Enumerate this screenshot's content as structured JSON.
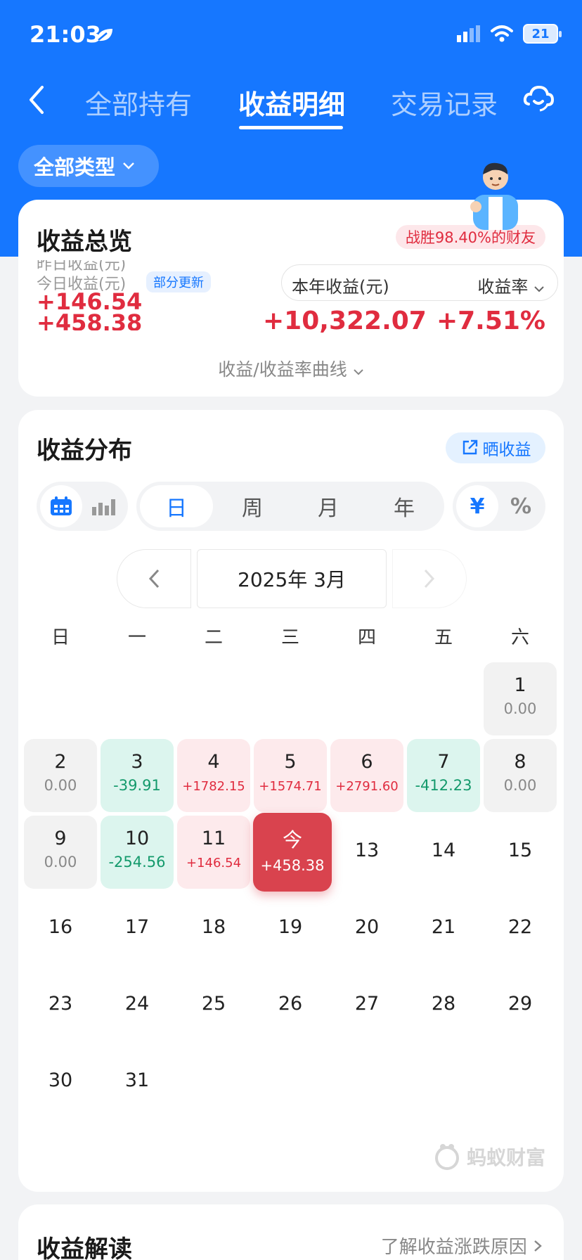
{
  "status": {
    "time": "21:03",
    "battery": "21"
  },
  "nav": {
    "tabs": [
      {
        "label": "全部持有"
      },
      {
        "label": "收益明细"
      },
      {
        "label": "交易记录"
      }
    ]
  },
  "filter": {
    "label": "全部类型"
  },
  "overview": {
    "title": "收益总览",
    "win_badge": "战胜98.40%的财友",
    "yesterday_label_partial": "昨日收益(元)",
    "today_label": "今日收益(元)",
    "partial_update": "部分更新",
    "yesterday_value_partial": "+146.54",
    "today_value": "+458.38",
    "year_label": "本年收益(元)",
    "rate_selector": "收益率",
    "year_value": "+10,322.07",
    "rate_value": "+7.51%",
    "curve_link": "收益/收益率曲线"
  },
  "distribution": {
    "title": "收益分布",
    "share_label": "晒收益",
    "periods": [
      "日",
      "周",
      "月",
      "年"
    ],
    "unit_yuan": "¥",
    "unit_percent": "%",
    "month": "2025年 3月",
    "weekdays": [
      "日",
      "一",
      "二",
      "三",
      "四",
      "五",
      "六"
    ],
    "days": [
      {
        "num": "1",
        "amt": "0.00",
        "type": "zero"
      },
      {
        "num": "2",
        "amt": "0.00",
        "type": "zero"
      },
      {
        "num": "3",
        "amt": "-39.91",
        "type": "loss"
      },
      {
        "num": "4",
        "amt": "+1782.15",
        "type": "gain"
      },
      {
        "num": "5",
        "amt": "+1574.71",
        "type": "gain"
      },
      {
        "num": "6",
        "amt": "+2791.60",
        "type": "gain"
      },
      {
        "num": "7",
        "amt": "-412.23",
        "type": "loss"
      },
      {
        "num": "8",
        "amt": "0.00",
        "type": "zero"
      },
      {
        "num": "9",
        "amt": "0.00",
        "type": "zero"
      },
      {
        "num": "10",
        "amt": "-254.56",
        "type": "loss"
      },
      {
        "num": "11",
        "amt": "+146.54",
        "type": "gain"
      },
      {
        "num": "今",
        "amt": "+458.38",
        "type": "today"
      },
      {
        "num": "13",
        "amt": "",
        "type": "plain"
      },
      {
        "num": "14",
        "amt": "",
        "type": "plain"
      },
      {
        "num": "15",
        "amt": "",
        "type": "plain"
      },
      {
        "num": "16",
        "amt": "",
        "type": "plain"
      },
      {
        "num": "17",
        "amt": "",
        "type": "plain"
      },
      {
        "num": "18",
        "amt": "",
        "type": "plain"
      },
      {
        "num": "19",
        "amt": "",
        "type": "plain"
      },
      {
        "num": "20",
        "amt": "",
        "type": "plain"
      },
      {
        "num": "21",
        "amt": "",
        "type": "plain"
      },
      {
        "num": "22",
        "amt": "",
        "type": "plain"
      },
      {
        "num": "23",
        "amt": "",
        "type": "plain"
      },
      {
        "num": "24",
        "amt": "",
        "type": "plain"
      },
      {
        "num": "25",
        "amt": "",
        "type": "plain"
      },
      {
        "num": "26",
        "amt": "",
        "type": "plain"
      },
      {
        "num": "27",
        "amt": "",
        "type": "plain"
      },
      {
        "num": "28",
        "amt": "",
        "type": "plain"
      },
      {
        "num": "29",
        "amt": "",
        "type": "plain"
      },
      {
        "num": "30",
        "amt": "",
        "type": "plain"
      },
      {
        "num": "31",
        "amt": "",
        "type": "plain"
      }
    ],
    "brand": "蚂蚁财富"
  },
  "interpretation": {
    "title": "收益解读",
    "link": "了解收益涨跌原因"
  },
  "colors": {
    "primary": "#1677ff",
    "gain": "#e02c3f",
    "loss": "#149a6c",
    "today": "#d9434e"
  }
}
